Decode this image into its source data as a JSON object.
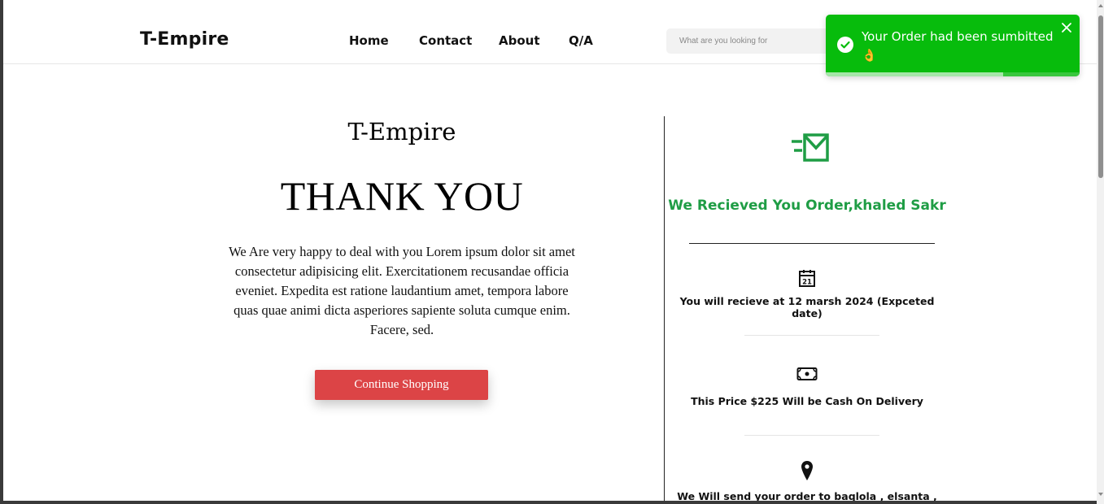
{
  "navbar": {
    "brand": "T-Empire",
    "links": [
      "Home",
      "Contact",
      "About",
      "Q/A"
    ],
    "search_placeholder": "What are you looking for"
  },
  "thanks": {
    "store_name": "T-Empire",
    "heading": "THANK YOU",
    "message": "We Are very happy to deal with you Lorem ipsum dolor sit amet consectetur adipisicing elit. Exercitationem recusandae officia eveniet. Expedita est ratione laudantium amet, tempora labore quas quae animi dicta asperiores sapiente soluta cumque enim. Facere, sed.",
    "button_label": "Continue Shopping"
  },
  "order": {
    "received_text": "We Recieved You Order,khaled Sakr",
    "calendar_day": "21",
    "delivery_date_text": "You will recieve at 12 marsh 2024 (Expceted date)",
    "price_text": "This Price $225 Will be Cash On Delivery",
    "address_text": "We Will send your order to baqlola , elsanta ,"
  },
  "toast": {
    "message": "Your Order had been sumbitted",
    "emoji": "👌",
    "progress_fraction": 0.7
  },
  "colors": {
    "accent_green": "#1f9d45",
    "button_red": "#dc4446",
    "toast_green": "#07bc0c"
  },
  "icons": {
    "mail": "mail-fast-icon",
    "calendar": "calendar-icon",
    "cash": "cash-icon",
    "location": "map-pin-icon",
    "toast_status": "check-circle-icon",
    "toast_close": "close-icon"
  }
}
